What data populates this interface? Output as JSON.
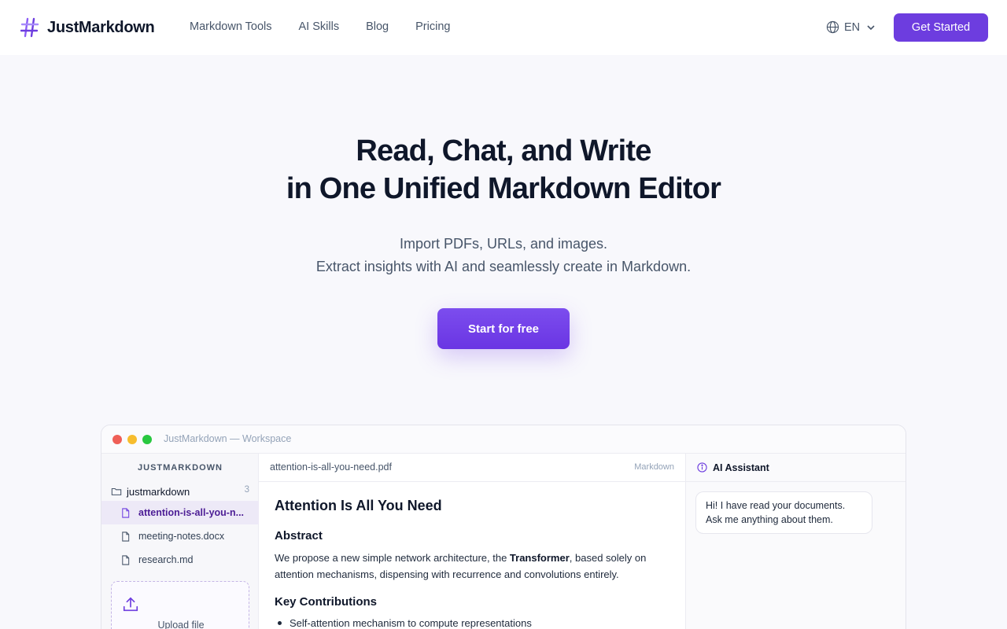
{
  "nav": {
    "brand": "JustMarkdown",
    "links": [
      "Markdown Tools",
      "AI Skills",
      "Blog",
      "Pricing"
    ],
    "language": "EN",
    "get_started": "Get Started"
  },
  "hero": {
    "title_line1": "Read, Chat, and Write",
    "title_line2": "in One Unified Markdown Editor",
    "sub_line1": "Import PDFs, URLs, and images.",
    "sub_line2": "Extract insights with AI and seamlessly create in Markdown.",
    "cta": "Start for free"
  },
  "workspace": {
    "window_title": "JustMarkdown — Workspace",
    "sidebar": {
      "heading": "JUSTMARKDOWN",
      "folder": "justmarkdown",
      "folder_count": "3",
      "files": [
        "attention-is-all-you-n...",
        "meeting-notes.docx",
        "research.md"
      ],
      "upload_label": "Upload file"
    },
    "doc": {
      "filename": "attention-is-all-you-need.pdf",
      "mode": "Markdown",
      "h1": "Attention Is All You Need",
      "abstract_heading": "Abstract",
      "abstract_pre": "We propose a new simple network architecture, the ",
      "abstract_bold": "Transformer",
      "abstract_post": ", based solely on attention mechanisms, dispensing with recurrence and convolutions entirely.",
      "contrib_heading": "Key Contributions",
      "bullet1": "Self-attention mechanism to compute representations"
    },
    "assistant": {
      "title": "AI Assistant",
      "message": "Hi! I have read your documents. Ask me anything about them."
    }
  },
  "colors": {
    "accent": "#6d3ddf",
    "background": "#f8f8fc"
  },
  "icons": [
    "hash-logo-icon",
    "globe-icon",
    "chevron-down-icon",
    "folder-icon",
    "file-icon",
    "upload-icon",
    "info-icon"
  ]
}
